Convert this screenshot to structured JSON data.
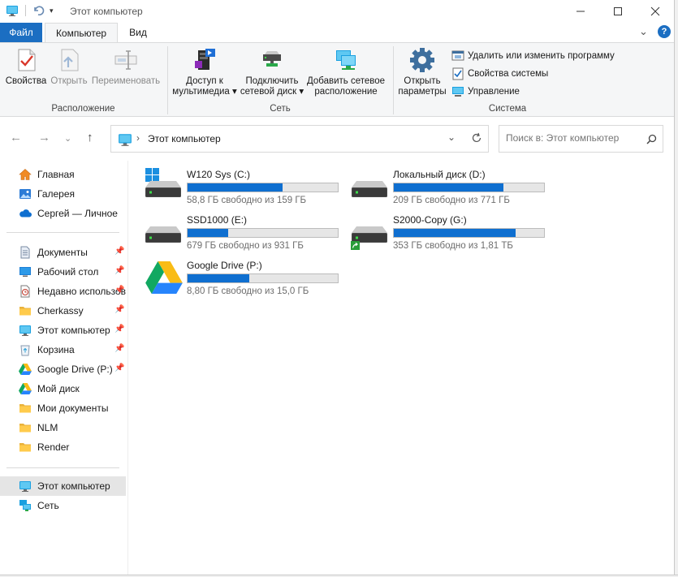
{
  "window": {
    "title": "Этот компьютер"
  },
  "ribbon": {
    "tabs": [
      {
        "label": "Файл"
      },
      {
        "label": "Компьютер"
      },
      {
        "label": "Вид"
      }
    ],
    "groups": {
      "location": {
        "label": "Расположение",
        "buttons": [
          {
            "label": "Свойства",
            "icon": "properties-checkmark-icon"
          },
          {
            "label": "Открыть",
            "icon": "open-icon"
          },
          {
            "label": "Переименовать",
            "icon": "rename-icon"
          }
        ]
      },
      "network": {
        "label": "Сеть",
        "buttons": [
          {
            "label": "Доступ к",
            "label2": "мультимедиа",
            "icon": "media-server-icon"
          },
          {
            "label": "Подключить",
            "label2": "сетевой диск",
            "icon": "map-network-drive-icon"
          },
          {
            "label": "Добавить сетевое",
            "label2": "расположение",
            "icon": "add-network-location-icon"
          }
        ]
      },
      "system": {
        "label": "Система",
        "open_settings": {
          "label": "Открыть",
          "label2": "параметры",
          "icon": "settings-gear-icon"
        },
        "small": [
          {
            "label": "Удалить или изменить программу",
            "icon": "uninstall-program-icon"
          },
          {
            "label": "Свойства системы",
            "icon": "system-properties-icon"
          },
          {
            "label": "Управление",
            "icon": "computer-management-icon"
          }
        ]
      }
    }
  },
  "address": {
    "path": "Этот компьютер",
    "search_placeholder": "Поиск в: Этот компьютер"
  },
  "sidebar": {
    "top": [
      {
        "label": "Главная",
        "icon": "home-icon"
      },
      {
        "label": "Галерея",
        "icon": "gallery-icon"
      },
      {
        "label": "Сергей — Личное",
        "icon": "onedrive-cloud-icon"
      }
    ],
    "pinned": [
      {
        "label": "Документы",
        "icon": "documents-icon",
        "pinned": true
      },
      {
        "label": "Рабочий стол",
        "icon": "desktop-icon",
        "pinned": true
      },
      {
        "label": "Недавно использованные",
        "icon": "recent-icon",
        "pinned": true
      },
      {
        "label": "Cherkassy",
        "icon": "folder-icon",
        "pinned": true
      },
      {
        "label": "Этот компьютер",
        "icon": "this-pc-icon",
        "pinned": true
      },
      {
        "label": "Корзина",
        "icon": "recycle-bin-icon",
        "pinned": true
      },
      {
        "label": "Google Drive (P:)",
        "icon": "google-drive-icon",
        "pinned": true
      },
      {
        "label": "Мой диск",
        "icon": "google-drive-icon",
        "pinned": false
      },
      {
        "label": "Мои документы",
        "icon": "folder-icon",
        "pinned": false
      },
      {
        "label": "NLM",
        "icon": "folder-icon",
        "pinned": false
      },
      {
        "label": "Render",
        "icon": "folder-icon",
        "pinned": false
      }
    ],
    "bottom": [
      {
        "label": "Этот компьютер",
        "icon": "this-pc-icon",
        "selected": true
      },
      {
        "label": "Сеть",
        "icon": "network-icon"
      }
    ]
  },
  "drives": [
    {
      "name": "W120 Sys (C:)",
      "free": "58,8 ГБ свободно из 159 ГБ",
      "used_fraction": 0.63,
      "icon": "system-drive-icon"
    },
    {
      "name": "Локальный диск (D:)",
      "free": "209 ГБ свободно из 771 ГБ",
      "used_fraction": 0.73,
      "icon": "hard-drive-icon"
    },
    {
      "name": "SSD1000 (E:)",
      "free": "679 ГБ свободно из 931 ГБ",
      "used_fraction": 0.27,
      "icon": "hard-drive-icon"
    },
    {
      "name": "S2000-Copy (G:)",
      "free": "353 ГБ свободно из 1,81 ТБ",
      "used_fraction": 0.81,
      "icon": "shared-drive-icon"
    },
    {
      "name": "Google Drive (P:)",
      "free": "8,80 ГБ свободно из 15,0 ГБ",
      "used_fraction": 0.41,
      "icon": "google-drive-icon"
    }
  ],
  "colors": {
    "accent": "#1b6ec2",
    "bar_fill": "#0f6fd0",
    "bar_track": "#e6e6e6"
  }
}
